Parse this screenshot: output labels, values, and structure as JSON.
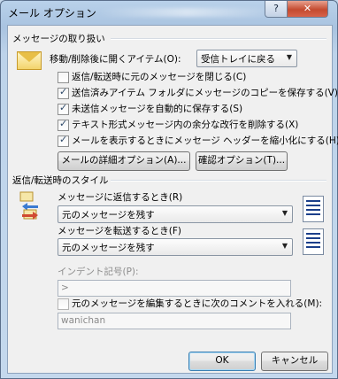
{
  "window": {
    "title": "メール オプション",
    "help_label": "?",
    "close_label": "✕"
  },
  "handling": {
    "group_title": "メッセージの取り扱い",
    "after_move_label": "移動/削除後に開くアイテム(O):",
    "after_move_value": "受信トレイに戻る",
    "checkboxes": [
      {
        "label": "返信/転送時に元のメッセージを閉じる(C)",
        "checked": false
      },
      {
        "label": "送信済みアイテム フォルダにメッセージのコピーを保存する(V)",
        "checked": true
      },
      {
        "label": "未送信メッセージを自動的に保存する(S)",
        "checked": true
      },
      {
        "label": "テキスト形式メッセージ内の余分な改行を削除する(X)",
        "checked": true
      },
      {
        "label": "メールを表示するときにメッセージ ヘッダーを縮小化にする(H)",
        "checked": true
      }
    ],
    "advanced_button": "メールの詳細オプション(A)...",
    "tracking_button": "確認オプション(T)..."
  },
  "reply": {
    "group_title": "返信/転送時のスタイル",
    "reply_label": "メッセージに返信するとき(R)",
    "reply_value": "元のメッセージを残す",
    "forward_label": "メッセージを転送するとき(F)",
    "forward_value": "元のメッセージを残す",
    "indent_label": "インデント記号(P):",
    "indent_value": ">",
    "mark_comments_label": "元のメッセージを編集するときに次のコメントを入れる(M):",
    "mark_comments_checked": false,
    "comment_value": "wanichan"
  },
  "footer": {
    "ok_label": "OK",
    "cancel_label": "キャンセル"
  }
}
